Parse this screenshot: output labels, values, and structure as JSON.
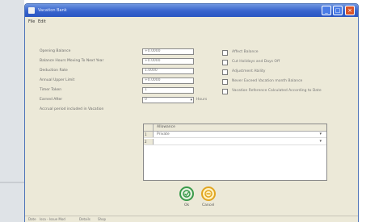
{
  "window": {
    "title": "Vacation Bank",
    "controls": {
      "minimize": "_",
      "maximize": "□",
      "close": "×"
    }
  },
  "menu": {
    "file": "File",
    "edit": "Edit"
  },
  "fields": [
    {
      "label": "Opening Balance",
      "value": "+0.0000"
    },
    {
      "label": "Balance Hours Moving To Next Year",
      "value": "+0.0000"
    },
    {
      "label": "Deduction Rate",
      "value": "1.0000"
    },
    {
      "label": "Annual Upper Limit",
      "value": "+0.0000"
    },
    {
      "label": "Timer Token",
      "value": "1"
    },
    {
      "label": "Earned After",
      "value": "0"
    }
  ],
  "earned_after_unit": "Hours",
  "accrued_label": "Accrual period included in Vacation",
  "checkboxes": [
    {
      "label": "Affect Balance",
      "checked": false
    },
    {
      "label": "Cut Holidays and Days Off",
      "checked": false
    },
    {
      "label": "Adjustment Ability",
      "checked": false
    },
    {
      "label": "Never Exceed Vacation month Balance",
      "checked": false
    },
    {
      "label": "Vacation Reference Calculated According to Date",
      "checked": false
    }
  ],
  "grid": {
    "header": "Allowance",
    "rows": [
      {
        "index": "1",
        "text": "Private"
      },
      {
        "index": "2",
        "text": ""
      }
    ]
  },
  "buttons": {
    "ok": "Ok",
    "cancel": "Cancel"
  },
  "status": [
    "Date",
    "Issa - Issue Mod",
    "Details",
    "Shop"
  ],
  "colors": {
    "ok": "#3a9a4a",
    "cancel": "#e1a521",
    "titlebar": "#3763cd"
  }
}
